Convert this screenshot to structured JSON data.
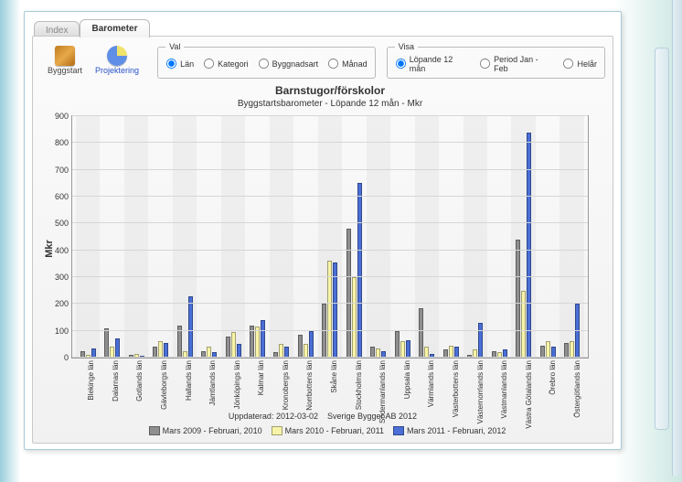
{
  "tabs": {
    "index": "Index",
    "barometer": "Barometer"
  },
  "icons": {
    "byggstart": "Byggstart",
    "projektering": "Projektering"
  },
  "groups": {
    "val": {
      "legend": "Val",
      "selected": "Län",
      "options": [
        "Län",
        "Kategori",
        "Byggnadsart",
        "Månad"
      ]
    },
    "visa": {
      "legend": "Visa",
      "selected": "Löpande 12 mån",
      "options": [
        "Löpande 12 mån",
        "Period Jan - Feb",
        "Helår"
      ]
    }
  },
  "footer": {
    "updated": "Uppdaterad: 2012-03-02",
    "copyright": "Sverige Bygger AB 2012"
  },
  "chart_data": {
    "type": "bar",
    "title": "Barnstugor/förskolor",
    "subtitle": "Byggstartsbarometer - Löpande 12 mån - Mkr",
    "ylabel": "Mkr",
    "ylim": [
      0,
      900
    ],
    "yticks": [
      0,
      100,
      200,
      300,
      400,
      500,
      600,
      700,
      800,
      900
    ],
    "categories": [
      "Blekinge län",
      "Dalarnas län",
      "Gotlands län",
      "Gävleborgs län",
      "Hallands län",
      "Jämtlands län",
      "Jönköpings län",
      "Kalmar län",
      "Kronobergs län",
      "Norrbottens län",
      "Skåne län",
      "Stockholms län",
      "Södermanlands län",
      "Uppsala län",
      "Värmlands län",
      "Västerbottens län",
      "Västernorrlands län",
      "Västmanlands län",
      "Västra Götalands län",
      "Örebro län",
      "Östergötlands län"
    ],
    "series": [
      {
        "name": "Mars 2009 - Februari, 2010",
        "values": [
          25,
          110,
          10,
          40,
          120,
          25,
          80,
          120,
          20,
          85,
          200,
          480,
          40,
          100,
          185,
          30,
          10,
          25,
          440,
          45,
          55
        ]
      },
      {
        "name": "Mars 2010 - Februari, 2011",
        "values": [
          10,
          40,
          15,
          60,
          25,
          40,
          95,
          115,
          50,
          50,
          360,
          300,
          35,
          60,
          40,
          45,
          30,
          20,
          250,
          60,
          60
        ]
      },
      {
        "name": "Mars 2011 - Februari, 2012",
        "values": [
          35,
          70,
          5,
          55,
          230,
          20,
          50,
          140,
          40,
          100,
          355,
          650,
          25,
          65,
          15,
          40,
          130,
          30,
          840,
          40,
          200
        ]
      }
    ],
    "legend_position": "bottom"
  }
}
